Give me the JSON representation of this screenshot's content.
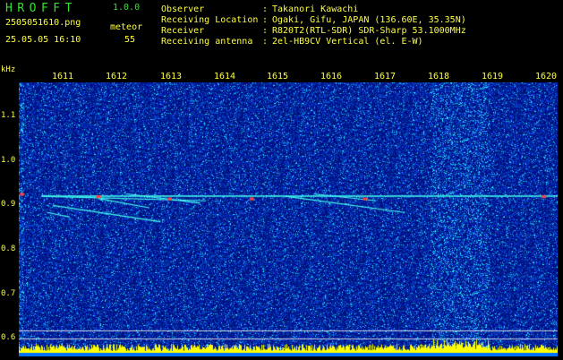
{
  "header": {
    "app_title": "HROFFT",
    "app_version": "1.0.0",
    "filename": "2505051610.png",
    "datetime": "25.05.05 16:10",
    "meteor_label": "meteor",
    "meteor_count": "55"
  },
  "station_info": [
    {
      "label": "Observer",
      "value": "Takanori Kawachi"
    },
    {
      "label": "Receiving Location",
      "value": "Ogaki, Gifu, JAPAN (136.60E, 35.35N)"
    },
    {
      "label": "Receiver",
      "value": "R820T2(RTL-SDR) SDR-Sharp 53.1000MHz"
    },
    {
      "label": "Receiving antenna",
      "value": "2el-HB9CV Vertical (el. E-W)"
    }
  ],
  "axis": {
    "y_unit": "kHz",
    "x_ticks": [
      "1611",
      "1612",
      "1613",
      "1614",
      "1615",
      "1616",
      "1617",
      "1618",
      "1619",
      "1620"
    ],
    "y_ticks": [
      "1.1",
      "1.0",
      "0.9",
      "0.8",
      "0.7",
      "0.6"
    ]
  },
  "colors": {
    "background": "#000000",
    "text_label": "#ffff3c",
    "title_green": "#33e033",
    "noise_base": "#000a8c",
    "echo_line": "#44ffee",
    "echo_hot": "#ff4040",
    "level_bar": "#ffff00",
    "level_base": "#0070ff"
  },
  "chart_data": {
    "type": "heatmap",
    "xlabel": "",
    "ylabel": "kHz",
    "xlim": [
      1610.6,
      1620.1
    ],
    "ylim": [
      0.58,
      1.17
    ],
    "carrier_frequency_khz": 0.925
  }
}
